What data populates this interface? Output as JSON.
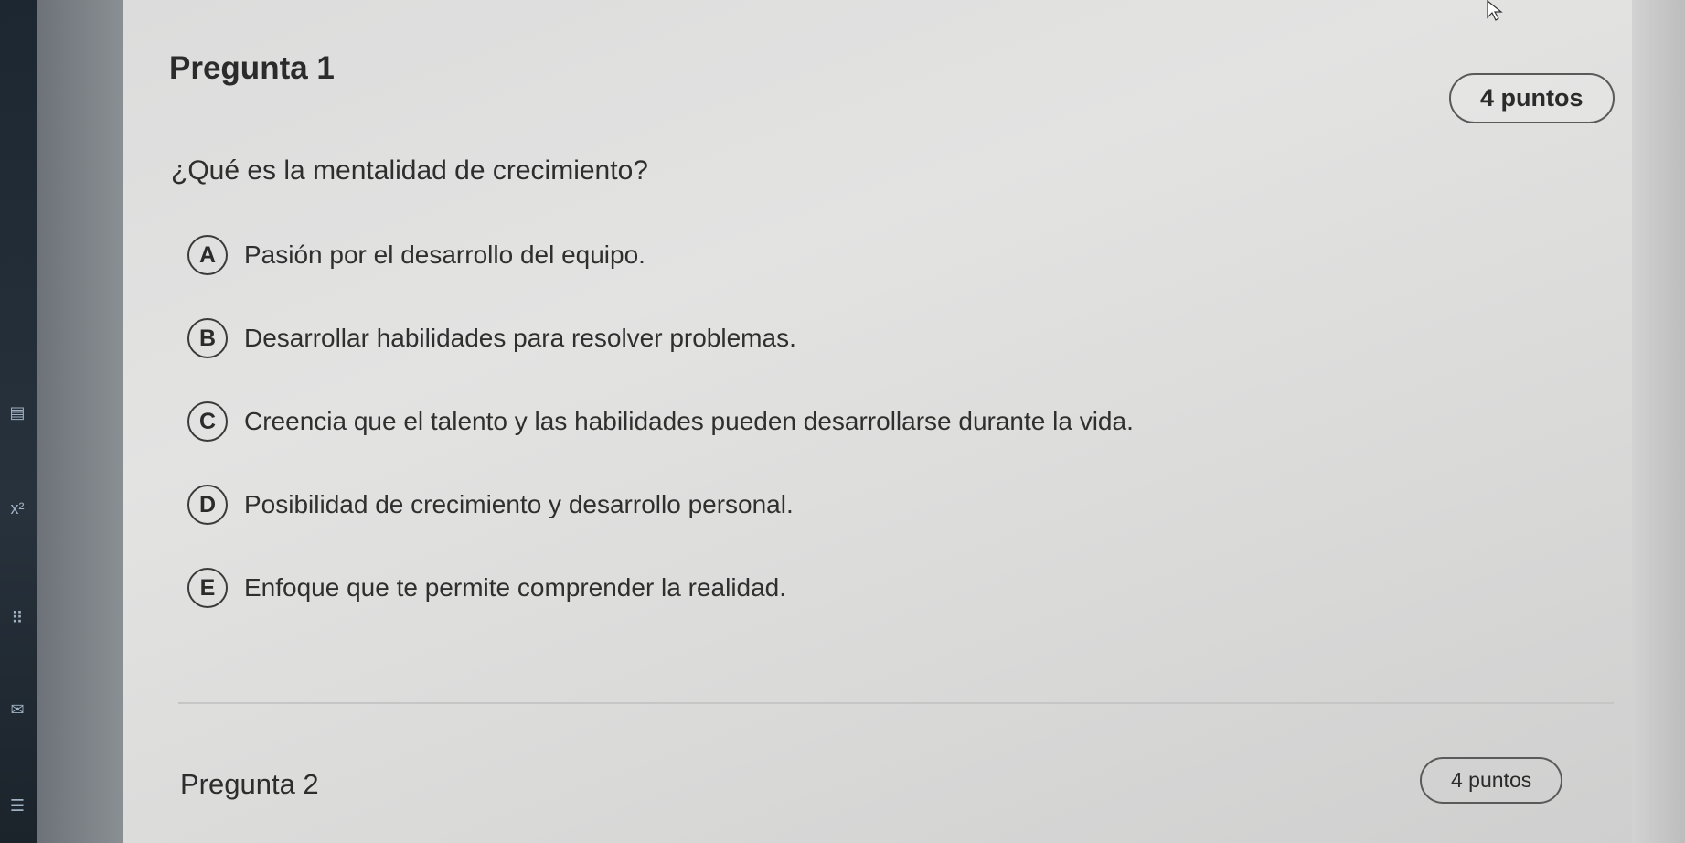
{
  "sidebar": {
    "icons": [
      "document-icon",
      "formula-icon",
      "grid-icon",
      "mail-icon",
      "list-icon"
    ]
  },
  "question1": {
    "title": "Pregunta 1",
    "points": "4 puntos",
    "text": "¿Qué es la mentalidad de crecimiento?",
    "options": [
      {
        "letter": "A",
        "label": "Pasión por el desarrollo del equipo."
      },
      {
        "letter": "B",
        "label": "Desarrollar habilidades para resolver problemas."
      },
      {
        "letter": "C",
        "label": "Creencia que el talento y las habilidades pueden desarrollarse durante la vida."
      },
      {
        "letter": "D",
        "label": "Posibilidad de crecimiento y desarrollo personal."
      },
      {
        "letter": "E",
        "label": "Enfoque que te permite comprender la realidad."
      }
    ]
  },
  "question2": {
    "title": "Pregunta 2",
    "points": "4 puntos"
  }
}
